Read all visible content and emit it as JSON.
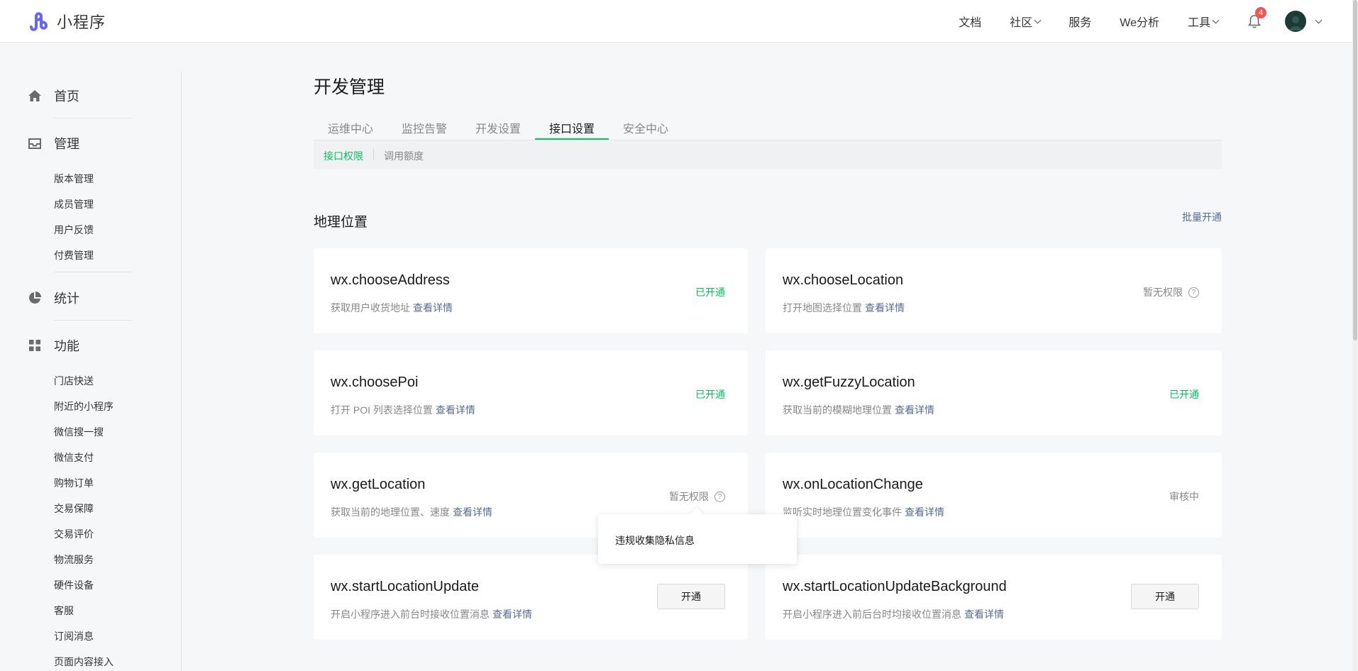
{
  "header": {
    "app_name": "小程序",
    "nav": [
      {
        "label": "文档",
        "dropdown": false
      },
      {
        "label": "社区",
        "dropdown": true
      },
      {
        "label": "服务",
        "dropdown": false
      },
      {
        "label": "We分析",
        "dropdown": false
      },
      {
        "label": "工具",
        "dropdown": true
      }
    ],
    "notification_count": "4"
  },
  "sidebar": {
    "home": "首页",
    "manage": "管理",
    "manage_items": [
      "版本管理",
      "成员管理",
      "用户反馈",
      "付费管理"
    ],
    "stats": "统计",
    "features": "功能",
    "feature_items": [
      "门店快送",
      "附近的小程序",
      "微信搜一搜",
      "微信支付",
      "购物订单",
      "交易保障",
      "交易评价",
      "物流服务",
      "硬件设备",
      "客服",
      "订阅消息",
      "页面内容接入"
    ]
  },
  "main": {
    "title": "开发管理",
    "tabs": [
      "运维中心",
      "监控告警",
      "开发设置",
      "接口设置",
      "安全中心"
    ],
    "active_tab": "接口设置",
    "subtabs": [
      "接口权限",
      "调用额度"
    ],
    "section_title": "地理位置",
    "batch_open": "批量开通",
    "detail_link": "查看详情",
    "cards": [
      {
        "api": "wx.chooseAddress",
        "desc": "获取用户收货地址",
        "status": "已开通",
        "type": "open"
      },
      {
        "api": "wx.chooseLocation",
        "desc": "打开地图选择位置",
        "status": "暂无权限",
        "type": "none"
      },
      {
        "api": "wx.choosePoi",
        "desc": "打开 POI 列表选择位置",
        "status": "已开通",
        "type": "open"
      },
      {
        "api": "wx.getFuzzyLocation",
        "desc": "获取当前的模糊地理位置",
        "status": "已开通",
        "type": "open"
      },
      {
        "api": "wx.getLocation",
        "desc": "获取当前的地理位置、速度",
        "status": "暂无权限",
        "type": "none"
      },
      {
        "api": "wx.onLocationChange",
        "desc": "监听实时地理位置变化事件",
        "status": "审核中",
        "type": "review"
      },
      {
        "api": "wx.startLocationUpdate",
        "desc": "开启小程序进入前台时接收位置消息",
        "status": "开通",
        "type": "button"
      },
      {
        "api": "wx.startLocationUpdateBackground",
        "desc": "开启小程序进入前后台时均接收位置消息",
        "status": "开通",
        "type": "button"
      }
    ],
    "tooltip": "违规收集隐私信息"
  },
  "colors": {
    "accent": "#07c160",
    "link": "#576b95",
    "badge": "#fa5151"
  }
}
